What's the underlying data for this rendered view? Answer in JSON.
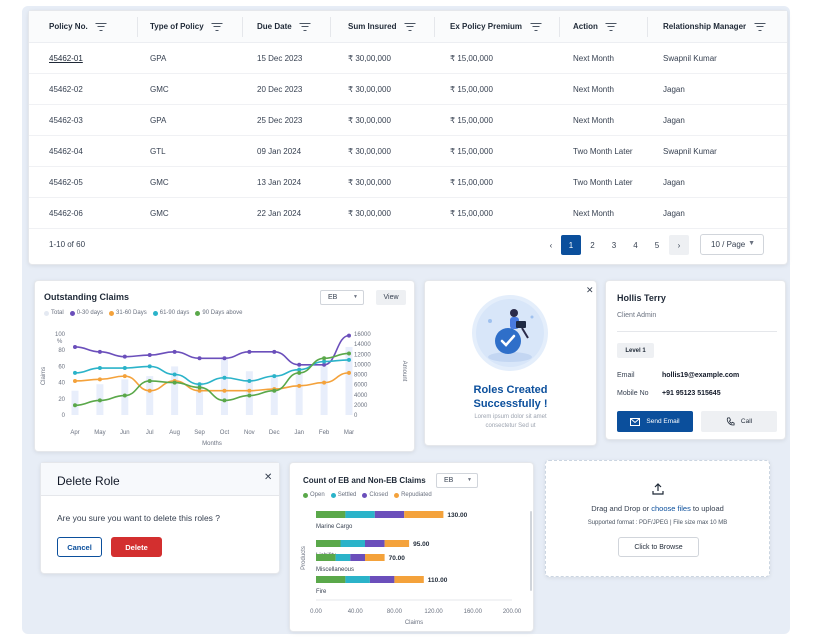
{
  "table": {
    "columns": [
      "Policy No.",
      "Type of Policy",
      "Due Date",
      "Sum Insured",
      "Ex Policy Premium",
      "Action",
      "Relationship Manager"
    ],
    "rows": [
      {
        "policy": "45462-01",
        "type": "GPA",
        "due": "15 Dec 2023",
        "sum": "₹ 30,00,000",
        "premium": "₹ 15,00,000",
        "action": "Next Month",
        "manager": "Swapnil Kumar"
      },
      {
        "policy": "45462-02",
        "type": "GMC",
        "due": "20 Dec 2023",
        "sum": "₹ 30,00,000",
        "premium": "₹ 15,00,000",
        "action": "Next Month",
        "manager": "Jagan"
      },
      {
        "policy": "45462-03",
        "type": "GPA",
        "due": "25 Dec 2023",
        "sum": "₹ 30,00,000",
        "premium": "₹ 15,00,000",
        "action": "Next Month",
        "manager": "Jagan"
      },
      {
        "policy": "45462-04",
        "type": "GTL",
        "due": "09 Jan 2024",
        "sum": "₹ 30,00,000",
        "premium": "₹ 15,00,000",
        "action": "Two Month Later",
        "manager": "Swapnil Kumar"
      },
      {
        "policy": "45462-05",
        "type": "GMC",
        "due": "13 Jan 2024",
        "sum": "₹ 30,00,000",
        "premium": "₹ 15,00,000",
        "action": "Two Month Later",
        "manager": "Jagan"
      },
      {
        "policy": "45462-06",
        "type": "GMC",
        "due": "22 Jan 2024",
        "sum": "₹ 30,00,000",
        "premium": "₹ 15,00,000",
        "action": "Next Month",
        "manager": "Jagan"
      }
    ],
    "pagination": {
      "range": "1-10 of 60",
      "prev": "‹",
      "pages": [
        "1",
        "2",
        "3",
        "4",
        "5"
      ],
      "active_page": "1",
      "next": "›",
      "per_page": "10 / Page"
    }
  },
  "outstanding": {
    "title": "Outstanding Claims",
    "select_value": "EB",
    "view_label": "View",
    "legend": [
      "Total",
      "0-30 days",
      "31-60 Days",
      "61-90 days",
      "90 Days above"
    ]
  },
  "roles_created": {
    "title_line1": "Roles Created",
    "title_line2": "Successfully !",
    "sub_line1": "Lorem ipsum dolor sit amet",
    "sub_line2": "consectetur Sed ut"
  },
  "contact": {
    "name": "Hollis Terry",
    "role": "Client Admin",
    "level": "Level 1",
    "email_label": "Email",
    "email": "hollis19@example.com",
    "mobile_label": "Mobile No",
    "mobile": "+91 95123 515645",
    "send_email": "Send Email",
    "call": "Call"
  },
  "delete_role": {
    "title": "Delete Role",
    "message": "Are you sure you want to delete this roles ?",
    "cancel": "Cancel",
    "delete": "Delete"
  },
  "eb_claims": {
    "title": "Count of EB and Non-EB Claims",
    "select_value": "EB",
    "legend": [
      "Open",
      "Settled",
      "Closed",
      "Repudiated"
    ]
  },
  "upload": {
    "text_prefix": "Drag and Drop or ",
    "link": "choose files",
    "text_suffix": " to upload",
    "format": "Supported format : PDF/JPEG | File size max 10 MB",
    "browse": "Click to Browse"
  },
  "colors": {
    "primary": "#0b4f9c",
    "danger": "#d32f2f",
    "purple": "#6b4fbb",
    "orange": "#f4a23b",
    "teal": "#2bb3c9",
    "green": "#5aa84a",
    "total_bar": "#e8eefb"
  },
  "chart_data": [
    {
      "type": "line",
      "title": "Outstanding Claims",
      "categories": [
        "Apr",
        "May",
        "Jun",
        "Jul",
        "Aug",
        "Sep",
        "Oct",
        "Nov",
        "Dec",
        "Jan",
        "Feb",
        "Mar"
      ],
      "xlabel": "Months",
      "ylabel": "Claims",
      "y2label": "Amount",
      "y_unit": "%",
      "ylim": [
        0,
        100
      ],
      "y_ticks": [
        0,
        20,
        40,
        60,
        80,
        100
      ],
      "y2lim": [
        0,
        16000
      ],
      "y2_ticks": [
        0,
        2000,
        4000,
        6000,
        8000,
        10000,
        12000,
        14000,
        16000
      ],
      "legend_position": "top-left",
      "bars": {
        "name": "Total",
        "values": [
          30,
          38,
          44,
          48,
          60,
          40,
          72,
          54,
          50,
          56,
          60,
          84
        ]
      },
      "series": [
        {
          "name": "0-30 days",
          "values": [
            84,
            78,
            72,
            74,
            78,
            70,
            70,
            78,
            78,
            62,
            62,
            98
          ]
        },
        {
          "name": "31-60 Days",
          "values": [
            42,
            44,
            48,
            30,
            42,
            30,
            30,
            30,
            32,
            36,
            40,
            52
          ]
        },
        {
          "name": "61-90 days",
          "values": [
            52,
            58,
            58,
            60,
            50,
            38,
            46,
            42,
            48,
            56,
            66,
            68
          ]
        },
        {
          "name": "90 Days above",
          "values": [
            12,
            18,
            24,
            42,
            40,
            34,
            18,
            24,
            30,
            52,
            70,
            76
          ]
        }
      ]
    },
    {
      "type": "bar",
      "orientation": "horizontal",
      "stacked": true,
      "title": "Count of EB and Non-EB Claims",
      "categories": [
        "Marine Cargo",
        "Liability",
        "Miscellaneous",
        "Fire"
      ],
      "xlabel": "Claims",
      "ylabel": "Products",
      "xlim": [
        0,
        200
      ],
      "x_ticks": [
        0,
        40,
        80,
        120,
        160,
        200
      ],
      "totals": [
        "130.00",
        "95.00",
        "70.00",
        "110.00"
      ],
      "legend_position": "top-left",
      "series": [
        {
          "name": "Open",
          "values": [
            30,
            25,
            20,
            30
          ]
        },
        {
          "name": "Settled",
          "values": [
            30,
            25,
            15,
            25
          ]
        },
        {
          "name": "Closed",
          "values": [
            30,
            20,
            15,
            25
          ]
        },
        {
          "name": "Repudiated",
          "values": [
            40,
            25,
            20,
            30
          ]
        }
      ]
    }
  ]
}
